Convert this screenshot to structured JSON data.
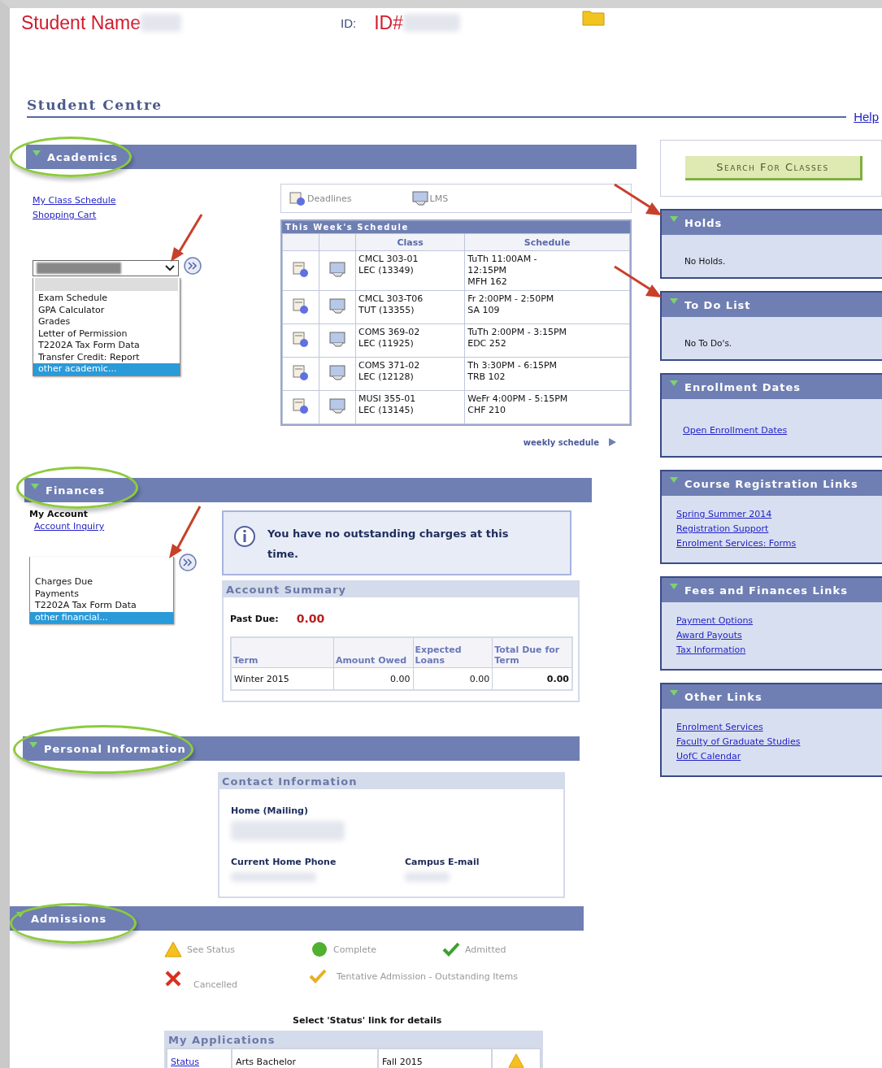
{
  "header": {
    "student_name": "Student Name",
    "id_label": "ID:",
    "id_value": "ID#"
  },
  "title": "Student Centre",
  "help": "Help",
  "academics": {
    "title": "Academics",
    "circled": true,
    "links": [
      "My Class Schedule",
      "Shopping Cart"
    ],
    "arrow": true,
    "menu": [
      {
        "label": "Exam Schedule",
        "selected": false
      },
      {
        "label": "GPA Calculator",
        "selected": false
      },
      {
        "label": "Grades",
        "selected": false
      },
      {
        "label": "Letter of Permission",
        "selected": false
      },
      {
        "label": "T2202A Tax Form Data",
        "selected": false
      },
      {
        "label": "Transfer Credit: Report",
        "selected": false
      },
      {
        "label": "other academic...",
        "selected": true
      }
    ],
    "tabs": [
      {
        "label": "Deadlines",
        "kind": "calendar"
      },
      {
        "label": "LMS",
        "kind": "monitor"
      }
    ],
    "schedule": {
      "title": "This Week's Schedule",
      "columns": [
        "Class",
        "Schedule"
      ],
      "rows": [
        {
          "class": [
            "CMCL 303-01",
            "LEC (13349)"
          ],
          "schedule": [
            "TuTh 11:00AM -",
            "12:15PM",
            "MFH 162"
          ]
        },
        {
          "class": [
            "CMCL 303-T06",
            "TUT (13355)"
          ],
          "schedule": [
            "Fr 2:00PM - 2:50PM",
            "SA 109"
          ]
        },
        {
          "class": [
            "COMS 369-02",
            "LEC (11925)"
          ],
          "schedule": [
            "TuTh 2:00PM - 3:15PM",
            "EDC 252"
          ]
        },
        {
          "class": [
            "COMS 371-02",
            "LEC (12128)"
          ],
          "schedule": [
            "Th 3:30PM - 6:15PM",
            "TRB 102"
          ]
        },
        {
          "class": [
            "MUSI 355-01",
            "LEC (13145)"
          ],
          "schedule": [
            "WeFr 4:00PM - 5:15PM",
            "CHF 210"
          ]
        }
      ]
    },
    "weekly_link": "weekly schedule"
  },
  "finances": {
    "title": "Finances",
    "circled": true,
    "heading": "My Account",
    "link": "Account Inquiry",
    "arrow": true,
    "menu": [
      {
        "label": "Charges Due",
        "selected": false
      },
      {
        "label": "Payments",
        "selected": false
      },
      {
        "label": "T2202A Tax Form Data",
        "selected": false
      },
      {
        "label": "other financial...",
        "selected": true
      }
    ],
    "notice": "You have no outstanding charges at this time.",
    "summary": {
      "title": "Account Summary",
      "past_due_label": "Past Due:",
      "past_due": "0.00",
      "columns": [
        "Term",
        "Amount Owed",
        "Expected Loans",
        "Total Due for Term"
      ],
      "rows": [
        [
          "Winter 2015",
          "0.00",
          "0.00",
          "0.00"
        ]
      ]
    }
  },
  "personal": {
    "title": "Personal Information",
    "circled": true,
    "contact": {
      "title": "Contact Information",
      "fields": [
        {
          "label": "Home (Mailing)"
        },
        {
          "label": "Current Home Phone"
        },
        {
          "label": "Campus E-mail"
        }
      ]
    }
  },
  "admissions": {
    "title": "Admissions",
    "circled": true,
    "legend": [
      {
        "kind": "warning",
        "label": "See Status"
      },
      {
        "kind": "complete",
        "label": "Complete"
      },
      {
        "kind": "admitted",
        "label": "Admitted"
      },
      {
        "kind": "cancelled",
        "label": "Cancelled"
      },
      {
        "kind": "tentative",
        "label": "Tentative Admission - Outstanding Items"
      }
    ],
    "hint": "Select 'Status' link for details",
    "applications": {
      "title": "My Applications",
      "rows": [
        {
          "link": "Status",
          "program": "Arts Bachelor",
          "term": "Fall 2015",
          "kind": "warning"
        }
      ]
    }
  },
  "sidebar": {
    "search_button": "Search For Classes",
    "panels": [
      {
        "title": "Holds",
        "arrow": true,
        "kind": "text",
        "text": "No Holds."
      },
      {
        "title": "To Do List",
        "arrow": true,
        "kind": "text",
        "text": "No To Do's."
      },
      {
        "title": "Enrollment Dates",
        "arrow": false,
        "kind": "links",
        "links": [
          "Open Enrollment Dates"
        ]
      },
      {
        "title": "Course Registration Links",
        "arrow": false,
        "kind": "links",
        "links": [
          "Spring Summer 2014",
          "Registration Support",
          "Enrolment Services: Forms"
        ]
      },
      {
        "title": "Fees and Finances Links",
        "arrow": false,
        "kind": "links",
        "links": [
          "Payment Options",
          "Award Payouts",
          "Tax Information"
        ]
      },
      {
        "title": "Other Links",
        "arrow": false,
        "kind": "links",
        "links": [
          "Enrolment Services",
          "Faculty of Graduate Studies",
          "UofC Calendar"
        ]
      }
    ]
  }
}
